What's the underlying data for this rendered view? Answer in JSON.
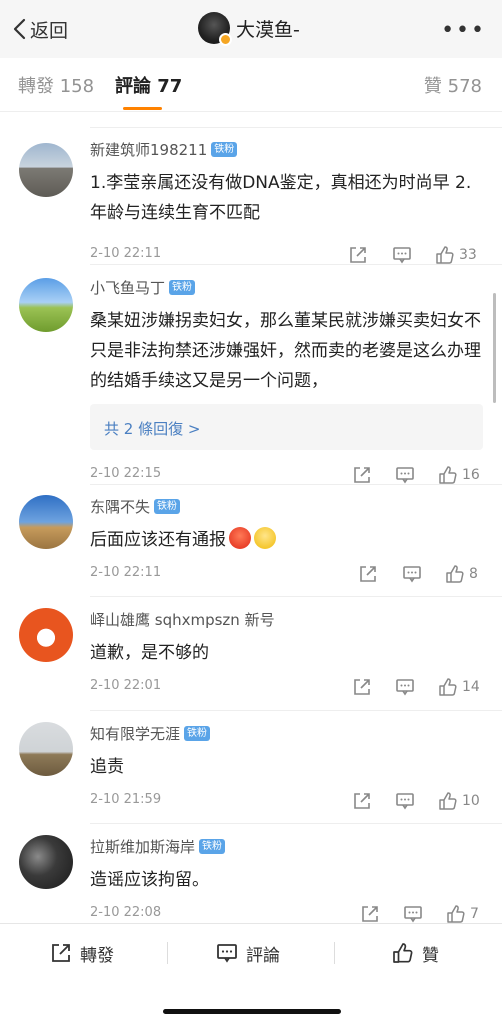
{
  "header": {
    "back_label": "返回",
    "user_name": "大漠鱼-",
    "more_label": "•••"
  },
  "tabs": {
    "repost": "轉發 158",
    "comment": "評論 77",
    "like": "贊 578"
  },
  "comments": [
    {
      "name": "新建筑师198211",
      "badge": "铁粉",
      "text": "1.李莹亲属还没有做DNA鉴定，真相还为时尚早 2.年龄与连续生育不匹配",
      "time": "2-10 22:11",
      "likes": "33"
    },
    {
      "name": "小飞鱼马丁",
      "badge": "铁粉",
      "text": "桑某妞涉嫌拐卖妇女，那么董某民就涉嫌买卖妇女不只是非法拘禁还涉嫌强奸，然而卖的老婆是这么办理的结婚手续这又是另一个问题，",
      "replies": "共 2 條回復 >",
      "time": "2-10 22:15",
      "likes": "16"
    },
    {
      "name": "东隅不失",
      "badge": "铁粉",
      "text": "后面应该还有通报",
      "time": "2-10 22:11",
      "likes": "8"
    },
    {
      "name": "峄山雄鹰 sqhxmpszn 新号",
      "badge": "",
      "text": "道歉，是不够的",
      "time": "2-10 22:01",
      "likes": "14"
    },
    {
      "name": "知有限学无涯",
      "badge": "铁粉",
      "text": "追责",
      "time": "2-10 21:59",
      "likes": "10"
    },
    {
      "name": "拉斯维加斯海岸",
      "badge": "铁粉",
      "text": "造谣应该拘留。",
      "time": "2-10 22:08",
      "likes": "7"
    }
  ],
  "bottom": {
    "repost": "轉發",
    "comment": "評論",
    "like": "贊"
  },
  "colors": {
    "accent": "#ff8200",
    "badge": "#5aa4e8",
    "link": "#4a7fc1"
  }
}
